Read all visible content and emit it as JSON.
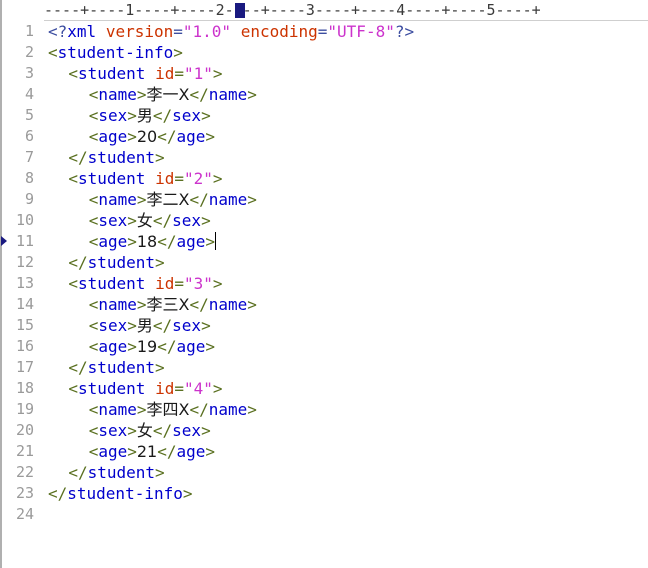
{
  "ruler": {
    "text": "----+----1----+----2----+----3----+----4----+----5----+",
    "cursor_column": 21
  },
  "bookmark_line": 11,
  "caret_line": 11,
  "lines": [
    {
      "num": "1",
      "parts": [
        [
          "pi",
          "<?"
        ],
        [
          "tn",
          "xml"
        ],
        [
          "pi",
          " "
        ],
        [
          "attr",
          "version"
        ],
        [
          "pi",
          "="
        ],
        [
          "val",
          "\"1.0\""
        ],
        [
          "pi",
          " "
        ],
        [
          "attr",
          "encoding"
        ],
        [
          "pi",
          "="
        ],
        [
          "val",
          "\"UTF-8\""
        ],
        [
          "pi",
          "?>"
        ]
      ]
    },
    {
      "num": "2",
      "parts": [
        [
          "tag",
          "<"
        ],
        [
          "tn",
          "student-info"
        ],
        [
          "tag",
          ">"
        ]
      ]
    },
    {
      "num": "3",
      "parts": [
        [
          "txt",
          "    "
        ],
        [
          "tag",
          "<"
        ],
        [
          "tn",
          "student"
        ],
        [
          "tag",
          " "
        ],
        [
          "attr",
          "id"
        ],
        [
          "tag",
          "="
        ],
        [
          "val",
          "\"1\""
        ],
        [
          "tag",
          ">"
        ]
      ]
    },
    {
      "num": "4",
      "parts": [
        [
          "txt",
          "        "
        ],
        [
          "tag",
          "<"
        ],
        [
          "tn",
          "name"
        ],
        [
          "tag",
          ">"
        ],
        [
          "txt",
          "李一X"
        ],
        [
          "tag",
          "</"
        ],
        [
          "tn",
          "name"
        ],
        [
          "tag",
          ">"
        ]
      ]
    },
    {
      "num": "5",
      "parts": [
        [
          "txt",
          "        "
        ],
        [
          "tag",
          "<"
        ],
        [
          "tn",
          "sex"
        ],
        [
          "tag",
          ">"
        ],
        [
          "txt",
          "男"
        ],
        [
          "tag",
          "</"
        ],
        [
          "tn",
          "sex"
        ],
        [
          "tag",
          ">"
        ]
      ]
    },
    {
      "num": "6",
      "parts": [
        [
          "txt",
          "        "
        ],
        [
          "tag",
          "<"
        ],
        [
          "tn",
          "age"
        ],
        [
          "tag",
          ">"
        ],
        [
          "txt",
          "20"
        ],
        [
          "tag",
          "</"
        ],
        [
          "tn",
          "age"
        ],
        [
          "tag",
          ">"
        ]
      ]
    },
    {
      "num": "7",
      "parts": [
        [
          "txt",
          "    "
        ],
        [
          "tag",
          "</"
        ],
        [
          "tn",
          "student"
        ],
        [
          "tag",
          ">"
        ]
      ]
    },
    {
      "num": "8",
      "parts": [
        [
          "txt",
          "    "
        ],
        [
          "tag",
          "<"
        ],
        [
          "tn",
          "student"
        ],
        [
          "tag",
          " "
        ],
        [
          "attr",
          "id"
        ],
        [
          "tag",
          "="
        ],
        [
          "val",
          "\"2\""
        ],
        [
          "tag",
          ">"
        ]
      ]
    },
    {
      "num": "9",
      "parts": [
        [
          "txt",
          "        "
        ],
        [
          "tag",
          "<"
        ],
        [
          "tn",
          "name"
        ],
        [
          "tag",
          ">"
        ],
        [
          "txt",
          "李二X"
        ],
        [
          "tag",
          "</"
        ],
        [
          "tn",
          "name"
        ],
        [
          "tag",
          ">"
        ]
      ]
    },
    {
      "num": "10",
      "parts": [
        [
          "txt",
          "        "
        ],
        [
          "tag",
          "<"
        ],
        [
          "tn",
          "sex"
        ],
        [
          "tag",
          ">"
        ],
        [
          "txt",
          "女"
        ],
        [
          "tag",
          "</"
        ],
        [
          "tn",
          "sex"
        ],
        [
          "tag",
          ">"
        ]
      ]
    },
    {
      "num": "11",
      "parts": [
        [
          "txt",
          "        "
        ],
        [
          "tag",
          "<"
        ],
        [
          "tn",
          "age"
        ],
        [
          "tag",
          ">"
        ],
        [
          "txt",
          "18"
        ],
        [
          "tag",
          "</"
        ],
        [
          "tn",
          "age"
        ],
        [
          "tag",
          ">"
        ]
      ]
    },
    {
      "num": "12",
      "parts": [
        [
          "txt",
          "    "
        ],
        [
          "tag",
          "</"
        ],
        [
          "tn",
          "student"
        ],
        [
          "tag",
          ">"
        ]
      ]
    },
    {
      "num": "13",
      "parts": [
        [
          "txt",
          "    "
        ],
        [
          "tag",
          "<"
        ],
        [
          "tn",
          "student"
        ],
        [
          "tag",
          " "
        ],
        [
          "attr",
          "id"
        ],
        [
          "tag",
          "="
        ],
        [
          "val",
          "\"3\""
        ],
        [
          "tag",
          ">"
        ]
      ]
    },
    {
      "num": "14",
      "parts": [
        [
          "txt",
          "        "
        ],
        [
          "tag",
          "<"
        ],
        [
          "tn",
          "name"
        ],
        [
          "tag",
          ">"
        ],
        [
          "txt",
          "李三X"
        ],
        [
          "tag",
          "</"
        ],
        [
          "tn",
          "name"
        ],
        [
          "tag",
          ">"
        ]
      ]
    },
    {
      "num": "15",
      "parts": [
        [
          "txt",
          "        "
        ],
        [
          "tag",
          "<"
        ],
        [
          "tn",
          "sex"
        ],
        [
          "tag",
          ">"
        ],
        [
          "txt",
          "男"
        ],
        [
          "tag",
          "</"
        ],
        [
          "tn",
          "sex"
        ],
        [
          "tag",
          ">"
        ]
      ]
    },
    {
      "num": "16",
      "parts": [
        [
          "txt",
          "        "
        ],
        [
          "tag",
          "<"
        ],
        [
          "tn",
          "age"
        ],
        [
          "tag",
          ">"
        ],
        [
          "txt",
          "19"
        ],
        [
          "tag",
          "</"
        ],
        [
          "tn",
          "age"
        ],
        [
          "tag",
          ">"
        ]
      ]
    },
    {
      "num": "17",
      "parts": [
        [
          "txt",
          "    "
        ],
        [
          "tag",
          "</"
        ],
        [
          "tn",
          "student"
        ],
        [
          "tag",
          ">"
        ]
      ]
    },
    {
      "num": "18",
      "parts": [
        [
          "txt",
          "    "
        ],
        [
          "tag",
          "<"
        ],
        [
          "tn",
          "student"
        ],
        [
          "tag",
          " "
        ],
        [
          "attr",
          "id"
        ],
        [
          "tag",
          "="
        ],
        [
          "val",
          "\"4\""
        ],
        [
          "tag",
          ">"
        ]
      ]
    },
    {
      "num": "19",
      "parts": [
        [
          "txt",
          "        "
        ],
        [
          "tag",
          "<"
        ],
        [
          "tn",
          "name"
        ],
        [
          "tag",
          ">"
        ],
        [
          "txt",
          "李四X"
        ],
        [
          "tag",
          "</"
        ],
        [
          "tn",
          "name"
        ],
        [
          "tag",
          ">"
        ]
      ]
    },
    {
      "num": "20",
      "parts": [
        [
          "txt",
          "        "
        ],
        [
          "tag",
          "<"
        ],
        [
          "tn",
          "sex"
        ],
        [
          "tag",
          ">"
        ],
        [
          "txt",
          "女"
        ],
        [
          "tag",
          "</"
        ],
        [
          "tn",
          "sex"
        ],
        [
          "tag",
          ">"
        ]
      ]
    },
    {
      "num": "21",
      "parts": [
        [
          "txt",
          "        "
        ],
        [
          "tag",
          "<"
        ],
        [
          "tn",
          "age"
        ],
        [
          "tag",
          ">"
        ],
        [
          "txt",
          "21"
        ],
        [
          "tag",
          "</"
        ],
        [
          "tn",
          "age"
        ],
        [
          "tag",
          ">"
        ]
      ]
    },
    {
      "num": "22",
      "parts": [
        [
          "txt",
          "    "
        ],
        [
          "tag",
          "</"
        ],
        [
          "tn",
          "student"
        ],
        [
          "tag",
          ">"
        ]
      ]
    },
    {
      "num": "23",
      "parts": [
        [
          "tag",
          "</"
        ],
        [
          "tn",
          "student-info"
        ],
        [
          "tag",
          ">"
        ]
      ]
    },
    {
      "num": "24",
      "parts": []
    }
  ]
}
